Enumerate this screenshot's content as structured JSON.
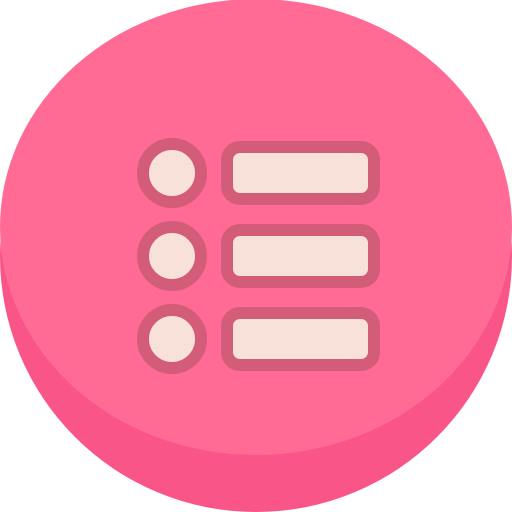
{
  "icon": {
    "name": "list-icon",
    "colors": {
      "button_face": "#FF6B94",
      "button_edge": "#F95589",
      "item_outline": "#D35C78",
      "item_fill": "#F8E1D8"
    },
    "rows": [
      {
        "bullet": "bullet-1",
        "bar": "bar-1"
      },
      {
        "bullet": "bullet-2",
        "bar": "bar-2"
      },
      {
        "bullet": "bullet-3",
        "bar": "bar-3"
      }
    ]
  }
}
